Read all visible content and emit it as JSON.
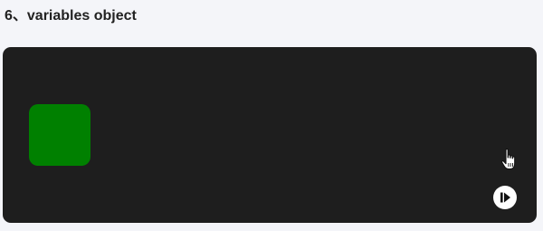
{
  "section": {
    "title": "6、variables object"
  },
  "demo": {
    "background_color": "#1e1e1e",
    "box_color": "#008000",
    "play_icon": "play-pause-icon",
    "cursor_icon": "hand-pointer-icon"
  }
}
